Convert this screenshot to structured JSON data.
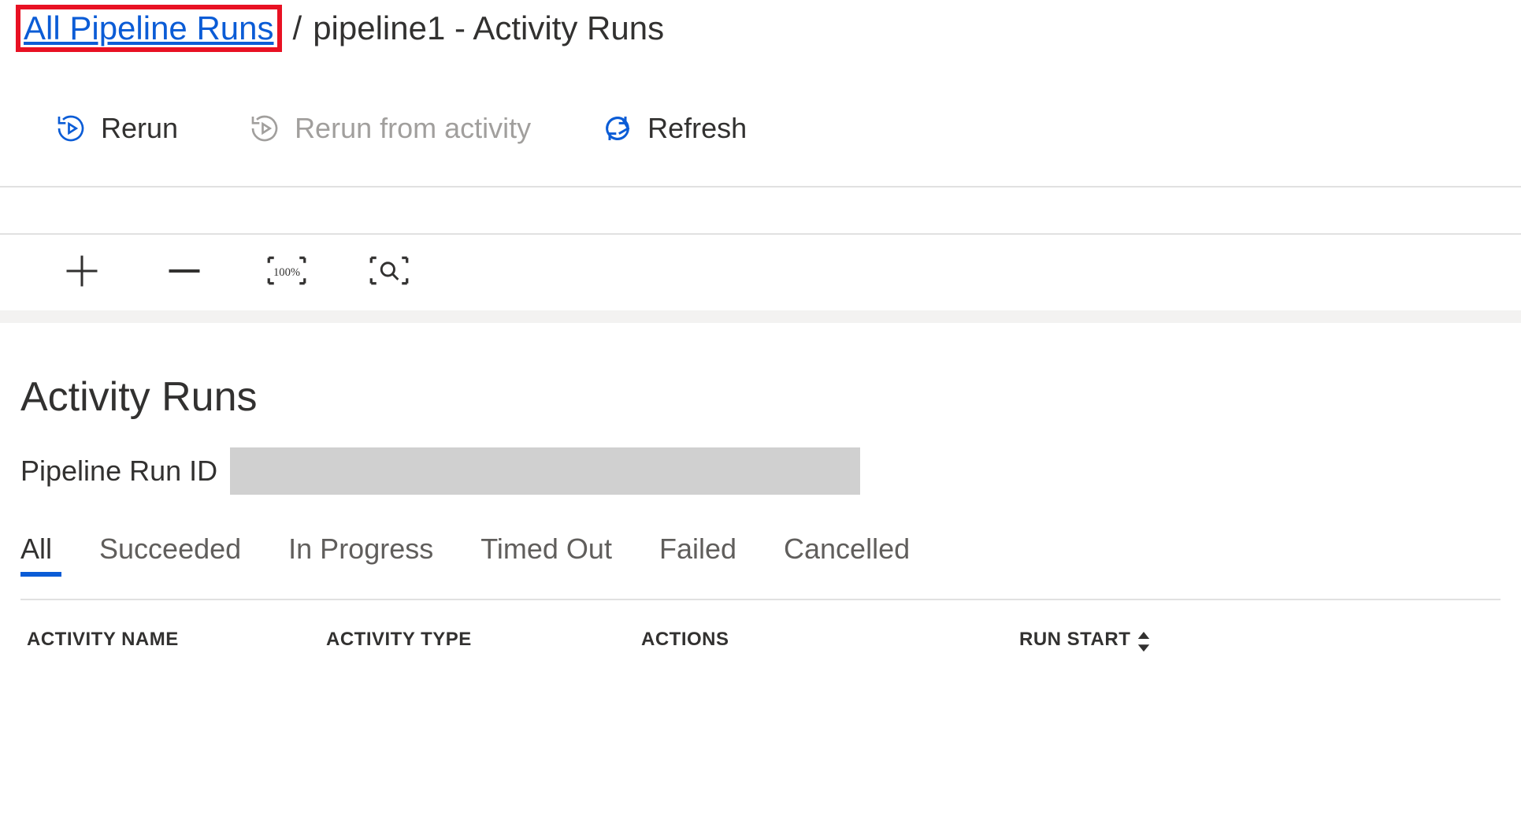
{
  "breadcrumb": {
    "link_label": "All Pipeline Runs",
    "separator": "/",
    "current": "pipeline1 - Activity Runs"
  },
  "toolbar": {
    "rerun_label": "Rerun",
    "rerun_from_activity_label": "Rerun from activity",
    "refresh_label": "Refresh"
  },
  "zoom": {
    "fit_label": "100%"
  },
  "section": {
    "title": "Activity Runs",
    "run_id_label": "Pipeline Run ID",
    "run_id_value": ""
  },
  "filters": {
    "tabs": [
      {
        "label": "All",
        "active": true
      },
      {
        "label": "Succeeded",
        "active": false
      },
      {
        "label": "In Progress",
        "active": false
      },
      {
        "label": "Timed Out",
        "active": false
      },
      {
        "label": "Failed",
        "active": false
      },
      {
        "label": "Cancelled",
        "active": false
      }
    ]
  },
  "table": {
    "columns": {
      "activity_name": "ACTIVITY NAME",
      "activity_type": "ACTIVITY TYPE",
      "actions": "ACTIONS",
      "run_start": "RUN START"
    }
  }
}
